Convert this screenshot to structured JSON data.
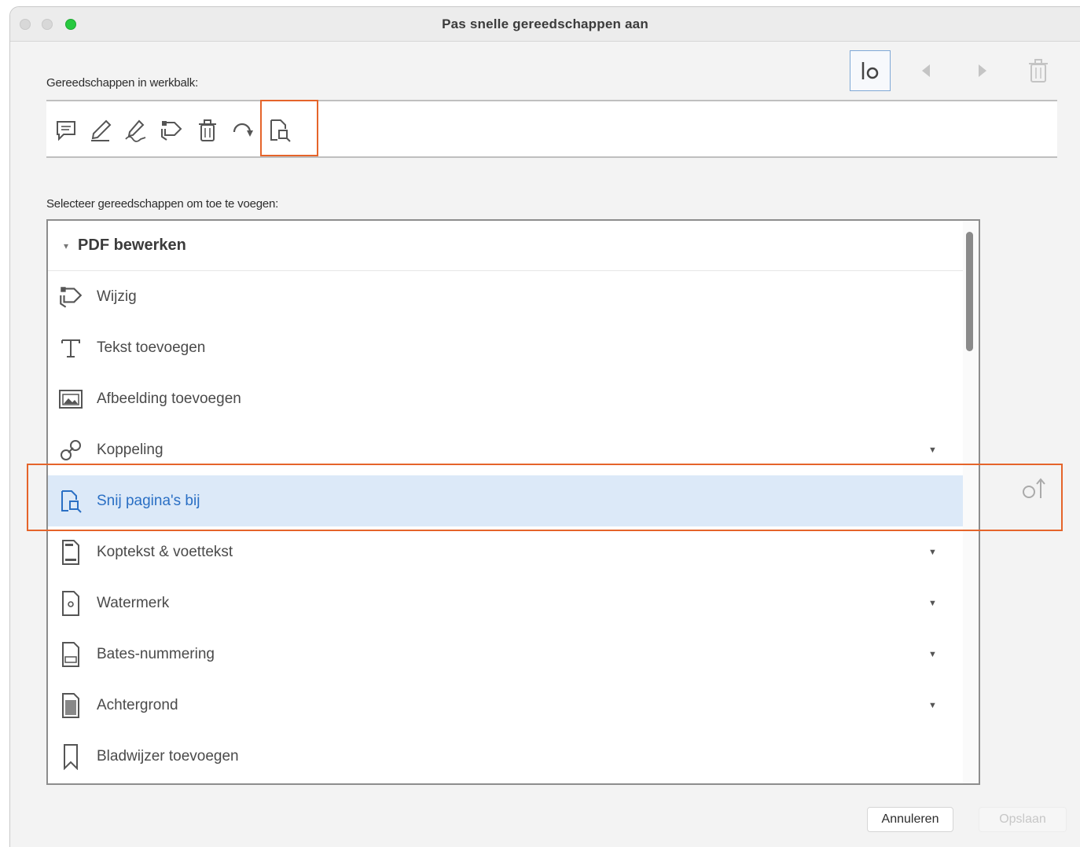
{
  "window": {
    "title": "Pas snelle gereedschappen aan"
  },
  "toolbar_section": {
    "label": "Gereedschappen in werkbalk:",
    "tools": [
      {
        "icon": "comment-icon"
      },
      {
        "icon": "highlighter-pen-icon"
      },
      {
        "icon": "sign-pen-icon"
      },
      {
        "icon": "edit-pdf-icon"
      },
      {
        "icon": "trash-icon"
      },
      {
        "icon": "rotate-icon"
      },
      {
        "icon": "crop-pages-icon"
      }
    ]
  },
  "top_controls": [
    {
      "icon": "separator-icon"
    },
    {
      "icon": "move-left-icon"
    },
    {
      "icon": "move-right-icon"
    },
    {
      "icon": "trash-icon"
    }
  ],
  "select_section": {
    "label": "Selecteer gereedschappen om toe te voegen:",
    "group": "PDF bewerken",
    "items": [
      {
        "label": "Wijzig",
        "icon": "edit-pdf-icon",
        "has_submenu": false,
        "selected": false
      },
      {
        "label": "Tekst toevoegen",
        "icon": "text-icon",
        "has_submenu": false,
        "selected": false
      },
      {
        "label": "Afbeelding toevoegen",
        "icon": "image-icon",
        "has_submenu": false,
        "selected": false
      },
      {
        "label": "Koppeling",
        "icon": "link-icon",
        "has_submenu": true,
        "selected": false
      },
      {
        "label": "Snij pagina's bij",
        "icon": "crop-pages-icon",
        "has_submenu": false,
        "selected": true
      },
      {
        "label": "Koptekst & voettekst",
        "icon": "header-footer-icon",
        "has_submenu": true,
        "selected": false
      },
      {
        "label": "Watermerk",
        "icon": "watermark-icon",
        "has_submenu": true,
        "selected": false
      },
      {
        "label": "Bates-nummering",
        "icon": "bates-icon",
        "has_submenu": true,
        "selected": false
      },
      {
        "label": "Achtergrond",
        "icon": "background-icon",
        "has_submenu": true,
        "selected": false
      },
      {
        "label": "Bladwijzer toevoegen",
        "icon": "bookmark-icon",
        "has_submenu": false,
        "selected": false
      }
    ]
  },
  "buttons": {
    "cancel": "Annuleren",
    "ok": "Opslaan"
  },
  "colors": {
    "highlight": "#e5642a",
    "selected_row": "#dce9f8",
    "selected_text": "#2a6fc4"
  }
}
